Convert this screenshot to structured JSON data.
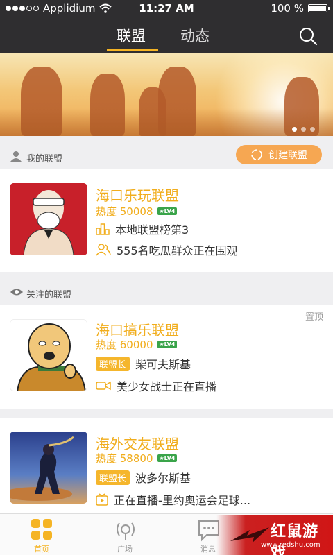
{
  "status": {
    "carrier": "Applidium",
    "time": "11:27 AM",
    "battery": "100 %",
    "battery_level": 1.0
  },
  "header": {
    "tabs": [
      "联盟",
      "动态"
    ],
    "active_tab": "联盟",
    "search_icon": "search-icon"
  },
  "banner": {
    "slides": 3,
    "active_slide": 0
  },
  "my_section": {
    "label": "我的联盟",
    "create_label": "创建联盟",
    "icon": "user-icon"
  },
  "my_alliance": {
    "title": "海口乐玩联盟",
    "heat": "热度 50008",
    "level": "★LV4",
    "rank": "本地联盟榜第3",
    "watching": "555名吃瓜群众正在围观"
  },
  "followed_section": {
    "label": "关注的联盟",
    "icon": "eye-icon"
  },
  "followed": [
    {
      "title": "海口搞乐联盟",
      "heat": "热度 60000",
      "level": "★LV4",
      "badge": "联盟长",
      "leader": "柴可夫斯基",
      "live": "美少女战士正在直播",
      "pinned": "置顶"
    },
    {
      "title": "海外交友联盟",
      "heat": "热度 58800",
      "level": "★LV4",
      "badge": "联盟长",
      "leader": "波多尔斯基",
      "live": "正在直播-里约奥运会足球..."
    }
  ],
  "bottom_nav": [
    {
      "label": "首页",
      "icon": "home-grid-icon",
      "active": true
    },
    {
      "label": "广场",
      "icon": "broadcast-icon",
      "active": false
    },
    {
      "label": "消息",
      "icon": "message-icon",
      "active": false
    },
    {
      "label": "",
      "icon": "profile-icon",
      "active": false
    }
  ],
  "watermark": {
    "brand": "红鼠游戏",
    "url": "www.redshu.com"
  },
  "colors": {
    "accent": "#f5b424",
    "header_bg": "#2f2e30",
    "level_badge": "#3aa44a"
  }
}
